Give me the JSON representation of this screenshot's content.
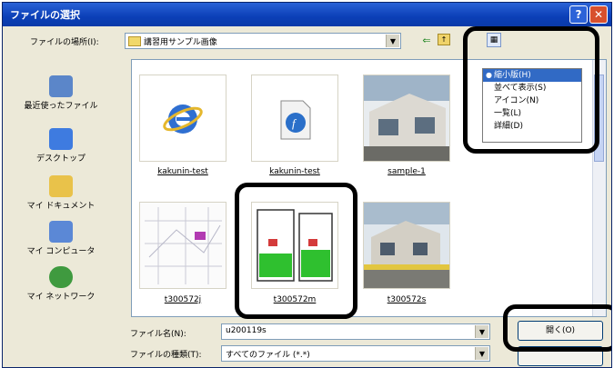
{
  "window": {
    "title": "ファイルの選択",
    "help_label": "?",
    "close_label": "✕"
  },
  "lookin": {
    "label": "ファイルの場所(I):",
    "value": "講習用サンプル画像"
  },
  "toolbar": {
    "back_icon": "back-arrow-icon",
    "up_icon": "up-folder-icon",
    "views_icon": "views-icon"
  },
  "places": [
    {
      "label": "最近使ったファイル",
      "icon": "recent-icon",
      "color": "#5b86c9"
    },
    {
      "label": "デスクトップ",
      "icon": "desktop-icon",
      "color": "#3e7be0"
    },
    {
      "label": "マイ ドキュメント",
      "icon": "my-documents-icon",
      "color": "#e9c24a"
    },
    {
      "label": "マイ コンピュータ",
      "icon": "my-computer-icon",
      "color": "#5b88d6"
    },
    {
      "label": "マイ ネットワーク",
      "icon": "my-network-icon",
      "color": "#3f9a3f"
    }
  ],
  "files": [
    {
      "name": "kakunin-test",
      "kind": "ie-shortcut"
    },
    {
      "name": "kakunin-test",
      "kind": "flash"
    },
    {
      "name": "sample-1",
      "kind": "photo-house"
    },
    {
      "name": "t300572j",
      "kind": "map"
    },
    {
      "name": "t300572m",
      "kind": "floorplan"
    },
    {
      "name": "t300572s",
      "kind": "photo-street"
    }
  ],
  "view_menu": {
    "items": [
      {
        "label": "縮小版(H)",
        "selected": true
      },
      {
        "label": "並べて表示(S)",
        "selected": false
      },
      {
        "label": "アイコン(N)",
        "selected": false
      },
      {
        "label": "一覧(L)",
        "selected": false
      },
      {
        "label": "詳細(D)",
        "selected": false
      }
    ],
    "bullet": "●"
  },
  "filename": {
    "label": "ファイル名(N):",
    "value": "u200119s"
  },
  "filetype": {
    "label": "ファイルの種類(T):",
    "value": "すべてのファイル (*.*)"
  },
  "open_button": {
    "label": "開く(O)"
  },
  "dropdown_glyph": "▼",
  "colors": {
    "title_bar": "#0b3fb7",
    "selection": "#316ac5",
    "annotation": "#000000"
  }
}
